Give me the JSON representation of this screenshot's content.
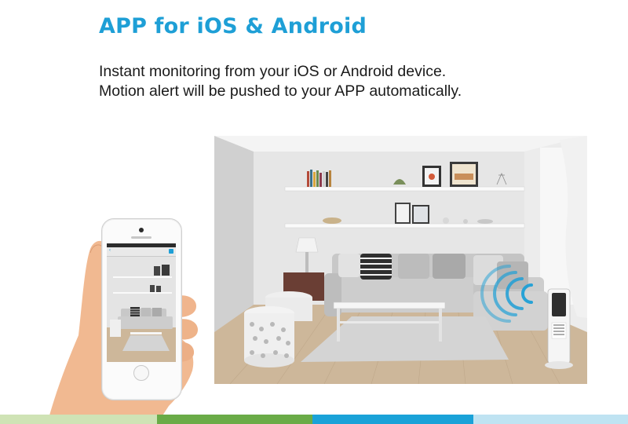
{
  "heading": "APP for iOS & Android",
  "description": {
    "line1": "Instant monitoring from your iOS or Android device.",
    "line2": "Motion alert will be pushed to your APP automatically."
  },
  "colors": {
    "heading_blue": "#1e9fd6",
    "body_text": "#1a1a1a",
    "stripe_light_green": "#cfe3b5",
    "stripe_green": "#6aab47",
    "stripe_blue": "#1aa2d8",
    "stripe_light_blue": "#bfe3f2"
  },
  "icons": {
    "wifi_signal": "wifi-signal-icon",
    "camera_device": "security-camera-icon"
  }
}
